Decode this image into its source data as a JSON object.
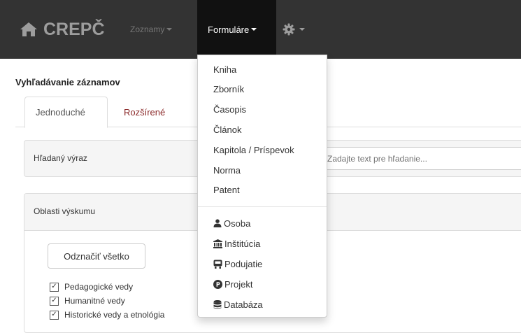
{
  "navbar": {
    "brand": "CREPČ",
    "brand_icon": "home-icon",
    "items": [
      {
        "label": "Zoznamy"
      },
      {
        "label": "Formuláre"
      }
    ],
    "settings_icon": "gear-icon"
  },
  "page": {
    "title": "Vyhľadávanie záznamov",
    "tabs": [
      {
        "label": "Jednoduché",
        "active": true
      },
      {
        "label": "Rozšírené",
        "active": false
      }
    ]
  },
  "search": {
    "label": "Hľadaný výraz",
    "placeholder": "Zadajte text pre hľadanie..."
  },
  "areas": {
    "label": "Oblasti výskumu",
    "unselect_all": "Odznačiť všetko",
    "items": [
      {
        "label": "Pedagogické vedy",
        "checked": true
      },
      {
        "label": "Humanitné vedy",
        "checked": true
      },
      {
        "label": "Historické vedy a etnológia",
        "checked": true
      }
    ]
  },
  "dropdown": {
    "items": [
      {
        "label": "Kniha"
      },
      {
        "label": "Zborník"
      },
      {
        "label": "Časopis"
      },
      {
        "label": "Článok"
      },
      {
        "label": "Kapitola / Príspevok"
      },
      {
        "label": "Norma"
      },
      {
        "label": "Patent"
      }
    ],
    "entities": [
      {
        "label": "Osoba",
        "icon": "person-icon"
      },
      {
        "label": "Inštitúcia",
        "icon": "institution-icon"
      },
      {
        "label": "Podujatie",
        "icon": "event-icon"
      },
      {
        "label": "Projekt",
        "icon": "project-icon"
      },
      {
        "label": "Databáza",
        "icon": "database-icon"
      }
    ]
  },
  "colors": {
    "navbar_bg": "#333333",
    "nav_active_bg": "#111111",
    "tab_link": "#8b2a2a"
  }
}
